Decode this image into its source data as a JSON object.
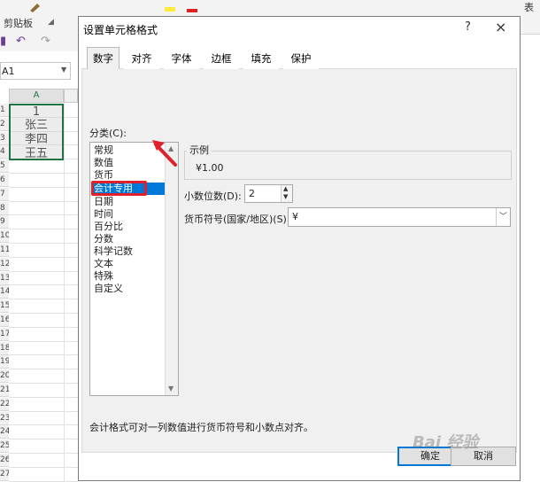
{
  "ribbon": {
    "clipboard_label": "剪贴板",
    "right_label": "表"
  },
  "namebox": {
    "value": "A1"
  },
  "sheet": {
    "column_a": "A",
    "rows": [
      "1",
      "2",
      "3",
      "4",
      "5",
      "6",
      "7",
      "8",
      "9",
      "10",
      "11",
      "12",
      "13",
      "14",
      "15",
      "16",
      "17",
      "18",
      "19",
      "20",
      "21",
      "22",
      "23",
      "24",
      "25",
      "26",
      "27"
    ],
    "cells": [
      "1",
      "张三",
      "李四",
      "王五"
    ]
  },
  "dialog": {
    "title": "设置单元格格式",
    "help": "?",
    "close": "×",
    "tabs": [
      "数字",
      "对齐",
      "字体",
      "边框",
      "填充",
      "保护"
    ],
    "active_tab": "数字",
    "category_label": "分类(C):",
    "categories": [
      "常规",
      "数值",
      "货币",
      "会计专用",
      "日期",
      "时间",
      "百分比",
      "分数",
      "科学记数",
      "文本",
      "特殊",
      "自定义"
    ],
    "selected_category": "会计专用",
    "sample_label": "示例",
    "sample_value": "¥1.00",
    "decimal_label": "小数位数(D):",
    "decimal_value": "2",
    "currency_label": "货币符号(国家/地区)(S):",
    "currency_value": "¥",
    "description": "会计格式可对一列数值进行货币符号和小数点对齐。",
    "ok": "确定",
    "cancel": "取消"
  },
  "watermark": "Bai 经验",
  "colors": {
    "accent": "#0078d7",
    "highlight": "#e0202a",
    "excel_green": "#217346"
  }
}
